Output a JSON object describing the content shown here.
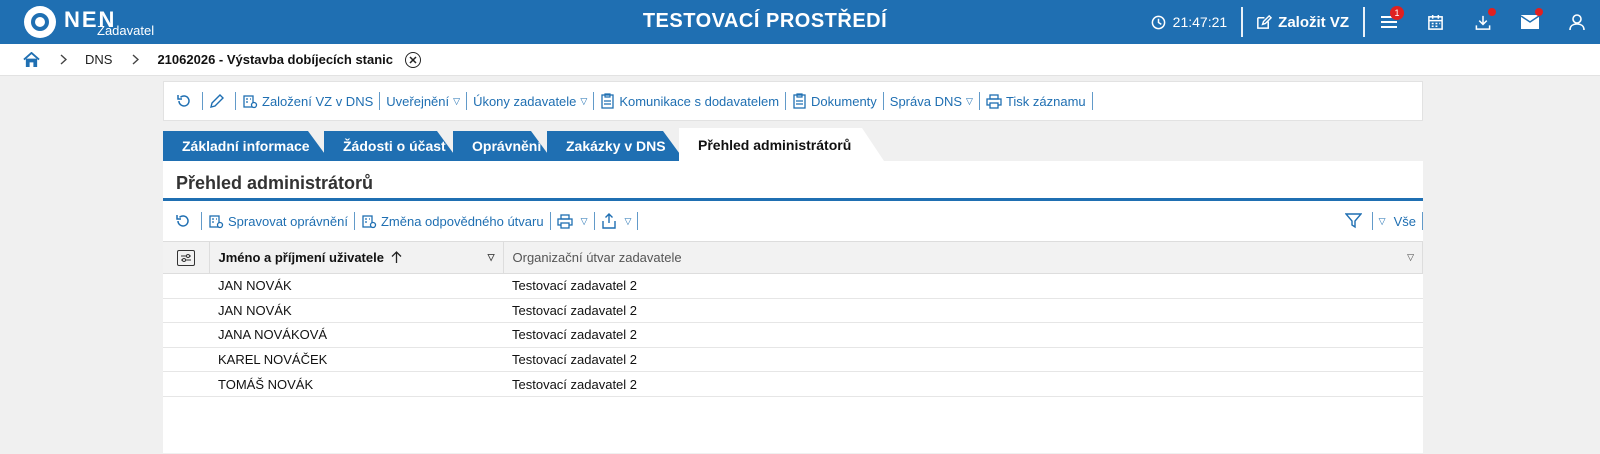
{
  "header": {
    "logo_text": "NEN",
    "logo_subtitle": "Zadavatel",
    "environment_title": "TESTOVACÍ PROSTŘEDÍ",
    "clock": "21:47:21",
    "create_label": "Založit VZ",
    "menu_badge": "1",
    "icons": [
      "clock-icon",
      "edit-icon",
      "menu-icon",
      "calendar-icon",
      "download-icon",
      "mail-icon",
      "user-icon"
    ],
    "brand_color": "#1f6fb2",
    "notification_color": "#e02020"
  },
  "breadcrumb": {
    "items": [
      "DNS"
    ],
    "current": "21062026 - Výstavba dobíjecích stanic"
  },
  "toolbar": {
    "create_in_dns": "Založení VZ v DNS",
    "publication": "Uveřejnění",
    "contracting_actions": "Úkony zadavatele",
    "supplier_communication": "Komunikace s dodavatelem",
    "documents": "Dokumenty",
    "dns_management": "Správa DNS",
    "print_record": "Tisk záznamu"
  },
  "tabs": [
    {
      "label": "Základní informace",
      "active": false
    },
    {
      "label": "Žádosti o účast",
      "active": false
    },
    {
      "label": "Oprávnění",
      "active": false
    },
    {
      "label": "Zakázky v DNS",
      "active": false
    },
    {
      "label": "Přehled administrátorů",
      "active": true
    }
  ],
  "panel": {
    "title": "Přehled administrátorů",
    "manage_permissions": "Spravovat oprávnění",
    "change_unit": "Změna odpovědného útvaru",
    "filter_all": "Vše"
  },
  "table": {
    "columns": [
      "Jméno a příjmení uživatele",
      "Organizační útvar zadavatele"
    ],
    "sort": "ascending",
    "rows": [
      [
        "JAN NOVÁK",
        "Testovací zadavatel 2"
      ],
      [
        "JAN NOVÁK",
        "Testovací zadavatel 2"
      ],
      [
        "JANA NOVÁKOVÁ",
        "Testovací zadavatel 2"
      ],
      [
        "KAREL NOVÁČEK",
        "Testovací zadavatel 2"
      ],
      [
        "TOMÁŠ NOVÁK",
        "Testovací zadavatel 2"
      ]
    ]
  }
}
